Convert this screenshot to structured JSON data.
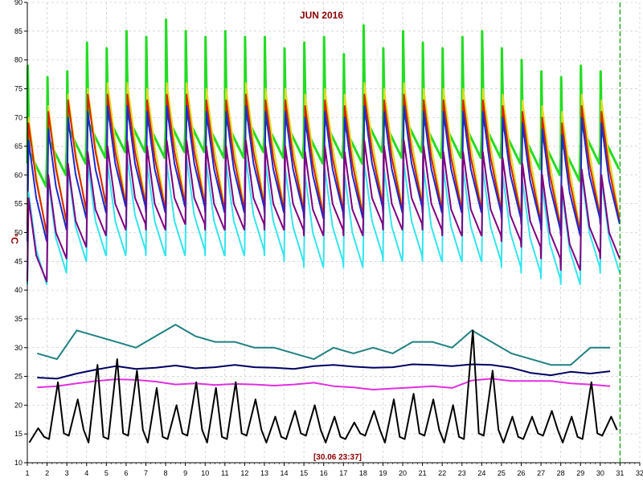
{
  "chart_data": {
    "type": "line",
    "title": "JUN 2016",
    "ylabel": "°C",
    "xlabel": "",
    "timestamp": "[30.06 23:37]",
    "xlim": [
      1,
      32
    ],
    "ylim": [
      10,
      90
    ],
    "x_ticks": [
      1,
      2,
      3,
      4,
      5,
      6,
      7,
      8,
      9,
      10,
      11,
      12,
      13,
      14,
      15,
      16,
      17,
      18,
      19,
      20,
      21,
      22,
      23,
      24,
      25,
      26,
      27,
      28,
      29,
      30,
      31,
      32
    ],
    "y_ticks": [
      10,
      15,
      20,
      25,
      30,
      35,
      40,
      45,
      50,
      55,
      60,
      65,
      70,
      75,
      80,
      85,
      90
    ],
    "x_tick_labels": [
      "1",
      "2",
      "3",
      "4",
      "5",
      "6",
      "7",
      "8",
      "9",
      "10",
      "11",
      "12",
      "13",
      "14",
      "15",
      "16",
      "17",
      "18",
      "19",
      "20",
      "21",
      "22",
      "23",
      "24",
      "25",
      "26",
      "27",
      "28",
      "29",
      "30",
      "31",
      "32"
    ],
    "y_tick_labels": [
      "10",
      "15",
      "20",
      "25",
      "30",
      "35",
      "40",
      "45",
      "50",
      "55",
      "60",
      "65",
      "70",
      "75",
      "80",
      "85",
      "90"
    ],
    "grid": true,
    "current_time_x": 31.0,
    "series": [
      {
        "color": "#22dd22",
        "style": "daily-spike",
        "values": [
          79,
          77,
          78,
          83,
          82,
          85,
          84,
          87,
          85,
          84,
          85,
          84,
          84,
          82,
          83,
          84,
          81,
          86,
          82,
          85,
          83,
          82,
          84,
          85,
          82,
          80,
          78,
          77,
          79,
          78
        ]
      },
      {
        "color": "#dddd22",
        "style": "daily-sawtooth",
        "values": [
          70,
          72,
          74,
          75,
          76,
          76,
          75,
          76,
          76,
          75,
          75,
          76,
          75,
          75,
          74,
          75,
          74,
          76,
          75,
          76,
          75,
          75,
          75,
          75,
          74,
          73,
          72,
          71,
          74,
          73
        ]
      },
      {
        "color": "#dd2200",
        "style": "daily-sawtooth",
        "values": [
          69,
          71,
          73,
          74,
          74,
          74,
          73,
          74,
          74,
          73,
          73,
          74,
          73,
          73,
          72,
          73,
          72,
          74,
          73,
          74,
          73,
          73,
          73,
          73,
          72,
          71,
          70,
          69,
          72,
          71
        ]
      },
      {
        "color": "#1a2ad0",
        "style": "daily-sawtooth",
        "values": [
          66,
          68,
          70,
          71,
          72,
          72,
          71,
          72,
          72,
          71,
          71,
          72,
          71,
          71,
          70,
          71,
          70,
          72,
          71,
          72,
          71,
          71,
          71,
          71,
          70,
          69,
          68,
          67,
          70,
          69
        ]
      },
      {
        "color": "#33e5f0",
        "style": "daily-sawtooth",
        "values": [
          57,
          59,
          61,
          62,
          62,
          63,
          62,
          62,
          63,
          62,
          62,
          63,
          62,
          61,
          60,
          61,
          60,
          62,
          61,
          62,
          61,
          61,
          61,
          61,
          60,
          59,
          58,
          57,
          60,
          59
        ]
      },
      {
        "color": "#800080",
        "style": "daily-sawtooth",
        "values": [
          56,
          60,
          62,
          64,
          65,
          66,
          65,
          66,
          66,
          65,
          65,
          66,
          65,
          65,
          64,
          65,
          64,
          66,
          65,
          66,
          65,
          64,
          64,
          64,
          63,
          62,
          60,
          58,
          61,
          60
        ]
      },
      {
        "color": "#208080",
        "values": [
          29,
          28,
          33,
          32,
          31,
          30,
          32,
          34,
          32,
          31,
          31,
          30,
          30,
          29,
          28,
          30,
          29,
          30,
          29,
          31,
          31,
          30,
          33,
          31,
          29,
          28,
          27,
          27,
          30,
          30
        ]
      },
      {
        "color": "#000060",
        "values": [
          24.8,
          24.6,
          25.5,
          26.2,
          26.8,
          26.3,
          26.5,
          26.9,
          26.4,
          26.6,
          27.0,
          26.6,
          26.5,
          26.3,
          26.8,
          27.0,
          26.7,
          26.5,
          26.6,
          27.1,
          27.0,
          26.8,
          27.1,
          27.0,
          26.5,
          25.6,
          25.2,
          25.8,
          25.5,
          25.9
        ]
      },
      {
        "color": "#e030e0",
        "values": [
          23.1,
          23.3,
          23.8,
          24.2,
          24.5,
          24.4,
          24.1,
          23.6,
          23.8,
          23.5,
          23.7,
          23.6,
          23.4,
          23.6,
          23.9,
          23.3,
          23.1,
          22.7,
          22.9,
          23.1,
          23.3,
          23.0,
          24.3,
          24.6,
          24.2,
          24.2,
          24.2,
          23.8,
          23.6,
          23.3
        ]
      },
      {
        "color": "#000000",
        "style": "daily-peak",
        "values": [
          16,
          24,
          21,
          27,
          28,
          26,
          23,
          20,
          24,
          23,
          24,
          21,
          18,
          19,
          20,
          18,
          17,
          19,
          21,
          22,
          21,
          20,
          33,
          26,
          18,
          18,
          19,
          18,
          24,
          18
        ]
      }
    ]
  }
}
